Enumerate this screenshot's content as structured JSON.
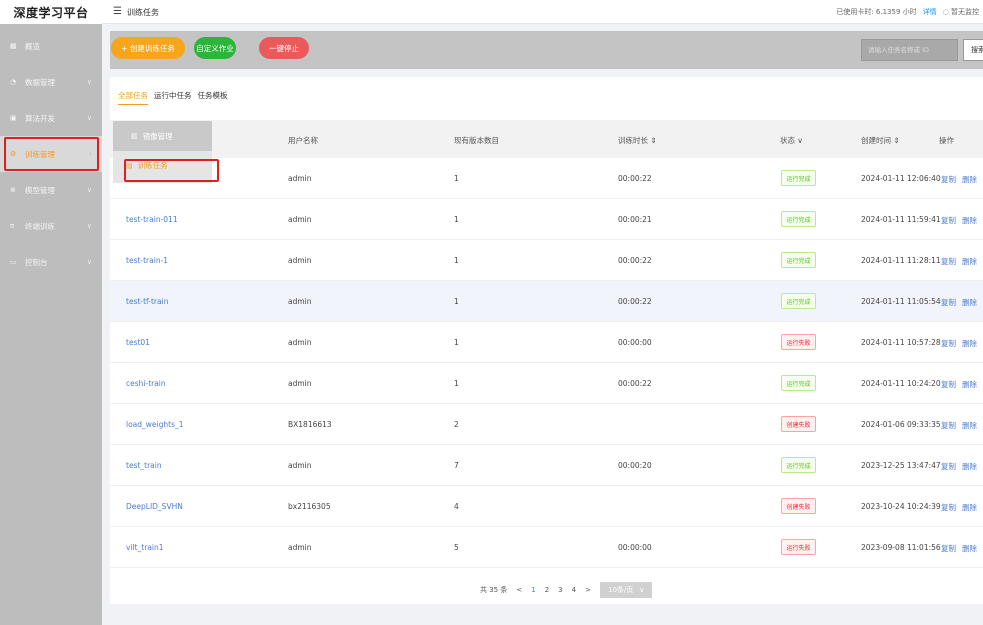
{
  "header": {
    "logo": "深度学习平台",
    "menu_icon": "menu-icon",
    "breadcrumb": "训练任务",
    "usage_text": "已使用卡时: 6.1359 小时",
    "usage_link": "详情",
    "status_text": "◌ 暂无监控"
  },
  "sidebar": {
    "items": [
      {
        "label": "概览",
        "icon": "overview-icon"
      },
      {
        "label": "数据管理",
        "icon": "data-icon"
      },
      {
        "label": "算法开发",
        "icon": "dev-icon"
      },
      {
        "label": "训练管理",
        "icon": "train-icon"
      },
      {
        "label": "模型管理",
        "icon": "model-icon"
      },
      {
        "label": "终端训练",
        "icon": "terminal-icon"
      },
      {
        "label": "控制台",
        "icon": "console-icon"
      }
    ]
  },
  "submenu": {
    "header": "镜像管理",
    "item": "训练任务"
  },
  "toolbar": {
    "create_label": "+ 创建训练任务",
    "custom_label": "自定义作业",
    "stop_label": "一键停止",
    "search_placeholder": "请输入任务名称或 ID",
    "search_label": "搜索"
  },
  "tabs": [
    {
      "label": "全部任务",
      "active": true
    },
    {
      "label": "运行中任务",
      "active": false
    },
    {
      "label": "任务模板",
      "active": false
    }
  ],
  "table": {
    "headers": {
      "user": "用户名称",
      "version": "现有版本数目",
      "duration": "训练时长 ⇕",
      "status": "状态 ∨",
      "created": "创建时间 ⇕",
      "ops": "操作"
    },
    "rows": [
      {
        "name": "",
        "user": "admin",
        "version": "1",
        "duration": "00:00:22",
        "status": "运行完成",
        "ok": true,
        "created": "2024-01-11 12:06:40"
      },
      {
        "name": "test-train-011",
        "user": "admin",
        "version": "1",
        "duration": "00:00:21",
        "status": "运行完成",
        "ok": true,
        "created": "2024-01-11 11:59:41"
      },
      {
        "name": "test-train-1",
        "user": "admin",
        "version": "1",
        "duration": "00:00:22",
        "status": "运行完成",
        "ok": true,
        "created": "2024-01-11 11:28:11"
      },
      {
        "name": "test-tf-train",
        "user": "admin",
        "version": "1",
        "duration": "00:00:22",
        "status": "运行完成",
        "ok": true,
        "created": "2024-01-11 11:05:54"
      },
      {
        "name": "test01",
        "user": "admin",
        "version": "1",
        "duration": "00:00:00",
        "status": "运行失败",
        "ok": false,
        "created": "2024-01-11 10:57:28"
      },
      {
        "name": "ceshi-train",
        "user": "admin",
        "version": "1",
        "duration": "00:00:22",
        "status": "运行完成",
        "ok": true,
        "created": "2024-01-11 10:24:20"
      },
      {
        "name": "load_weights_1",
        "user": "BX1816613",
        "version": "2",
        "duration": "",
        "status": "创建失败",
        "ok": false,
        "created": "2024-01-06 09:33:35"
      },
      {
        "name": "test_train",
        "user": "admin",
        "version": "7",
        "duration": "00:00:20",
        "status": "运行完成",
        "ok": true,
        "created": "2023-12-25 13:47:47"
      },
      {
        "name": "DeepLID_SVHN",
        "user": "bx2116305",
        "version": "4",
        "duration": "",
        "status": "创建失败",
        "ok": false,
        "created": "2023-10-24 10:24:39"
      },
      {
        "name": "vilt_train1",
        "user": "admin",
        "version": "5",
        "duration": "00:00:00",
        "status": "运行失败",
        "ok": false,
        "created": "2023-09-08 11:01:56"
      }
    ],
    "op_copy": "复制",
    "op_delete": "删除"
  },
  "pagination": {
    "total": "共 35 条",
    "prev": "<",
    "pages": [
      "1",
      "2",
      "3",
      "4"
    ],
    "current": "1",
    "next": ">",
    "page_size": "10条/页",
    "size_arrow": "∨"
  },
  "colors": {
    "accent": "#f29c1f",
    "create": "#f7a51c",
    "custom": "#2bb53a",
    "stop": "#eb5a5a",
    "link": "#4a7bd1"
  }
}
